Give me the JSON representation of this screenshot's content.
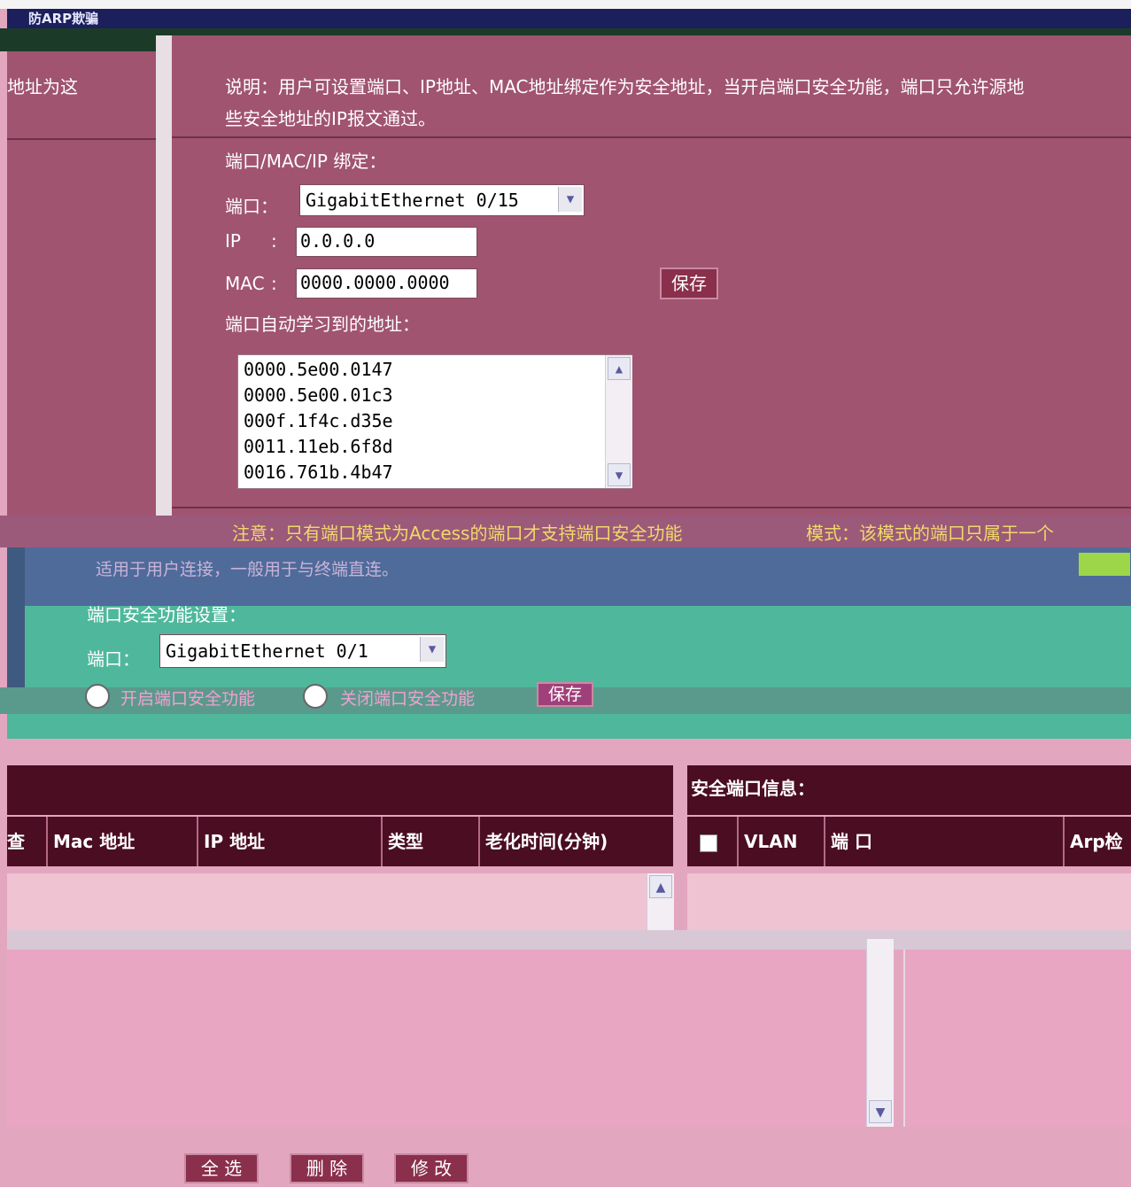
{
  "window": {
    "title": "防ARP欺骗"
  },
  "left_panel": {
    "text": "地址为这"
  },
  "description": {
    "line1": "说明：用户可设置端口、IP地址、MAC地址绑定作为安全地址，当开启端口安全功能，端口只允许源地",
    "line2": "些安全地址的IP报文通过。"
  },
  "binding": {
    "section_label": "端口/MAC/IP 绑定：",
    "port_label": "端口：",
    "port_value": "GigabitEthernet 0/15",
    "ip_label": "IP",
    "ip_colon": ":",
    "ip_value": "0.0.0.0",
    "mac_label": "MAC",
    "mac_colon": ":",
    "mac_value": "0000.0000.0000",
    "save_label": "保存",
    "learned_label": "端口自动学习到的地址：",
    "learned_addresses": [
      "0000.5e00.0147",
      "0000.5e00.01c3",
      "000f.1f4c.d35e",
      "0011.11eb.6f8d",
      "0016.761b.4b47"
    ]
  },
  "note": {
    "line1": "注意：只有端口模式为Access的端口才支持端口安全功能",
    "line2": "模式：该模式的端口只属于一个",
    "line3": "适用于用户连接，一般用于与终端直连。"
  },
  "security": {
    "section_label": "端口安全功能设置：",
    "port_label": "端口：",
    "port_value": "GigabitEthernet 0/1",
    "enable_label": "开启端口安全功能",
    "disable_label": "关闭端口安全功能",
    "save_label": "保存"
  },
  "left_table": {
    "columns": [
      "查",
      "Mac 地址",
      "IP 地址",
      "类型",
      "老化时间(分钟)"
    ]
  },
  "right_table": {
    "title": "安全端口信息：",
    "columns": [
      "VLAN",
      "端 口",
      "Arp检"
    ]
  },
  "actions": {
    "select_all": "全 选",
    "delete": "删 除",
    "modify": "修 改"
  }
}
